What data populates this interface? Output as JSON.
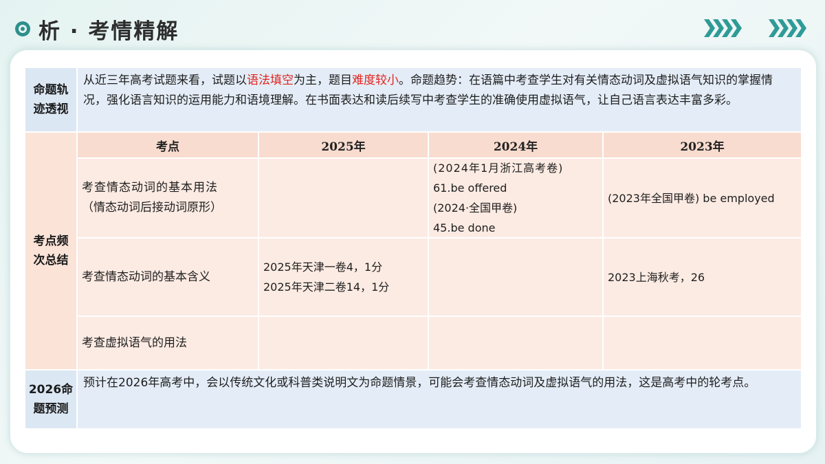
{
  "header": {
    "title": "析 · 考情精解"
  },
  "rows": {
    "trend": {
      "label": "命题轨迹透视",
      "text_parts": {
        "p1": "从近三年高考试题来看，试题以",
        "h1": "语法填空",
        "p2": "为主，题目",
        "h2": "难度较小",
        "p3": "。命题趋势：在语篇中考查学生对有关情态动词及虚拟语气知识的掌握情况，强化语言知识的运用能力和语境理解。在书面表达和读后续写中考查学生的准确使用虚拟语气，让自己语言表达丰富多彩。"
      }
    },
    "summary": {
      "label": "考点频次总结",
      "columns": [
        "考点",
        "2025年",
        "2024年",
        "2023年"
      ],
      "items": [
        {
          "point_line1": "考查情态动词的基本用法",
          "point_line2": "（情态动词后接动词原形）",
          "y2025": [],
          "y2024": [
            "(2024年1月浙江高考卷)",
            "61.be offered",
            "(2024·全国甲卷)",
            "45.be done"
          ],
          "y2023": [
            "(2023年全国甲卷) be employed"
          ]
        },
        {
          "point_line1": "考查情态动词的基本含义",
          "y2025": [
            "2025年天津一卷4，1分",
            "2025年天津二卷14，1分"
          ],
          "y2024": [],
          "y2023": [
            "2023上海秋考，26"
          ]
        },
        {
          "point_line1": "考查虚拟语气的用法",
          "y2025": [],
          "y2024": [],
          "y2023": []
        }
      ]
    },
    "forecast": {
      "label": "2026命题预测",
      "text": "预计在2026年高考中，会以传统文化或科普类说明文为命题情景，可能会考查情态动词及虚拟语气的用法，这是高考中的轮考点。"
    }
  },
  "colors": {
    "accent": "#2e8f8c",
    "highlight": "#e0241e",
    "label_blue": "#dbe7f3",
    "label_pink": "#fbe3d8",
    "table_header": "#f8dccf",
    "table_cell": "#fcebe3"
  },
  "icons": [
    "circle-bullet-icon",
    "chevron-right-icon"
  ]
}
